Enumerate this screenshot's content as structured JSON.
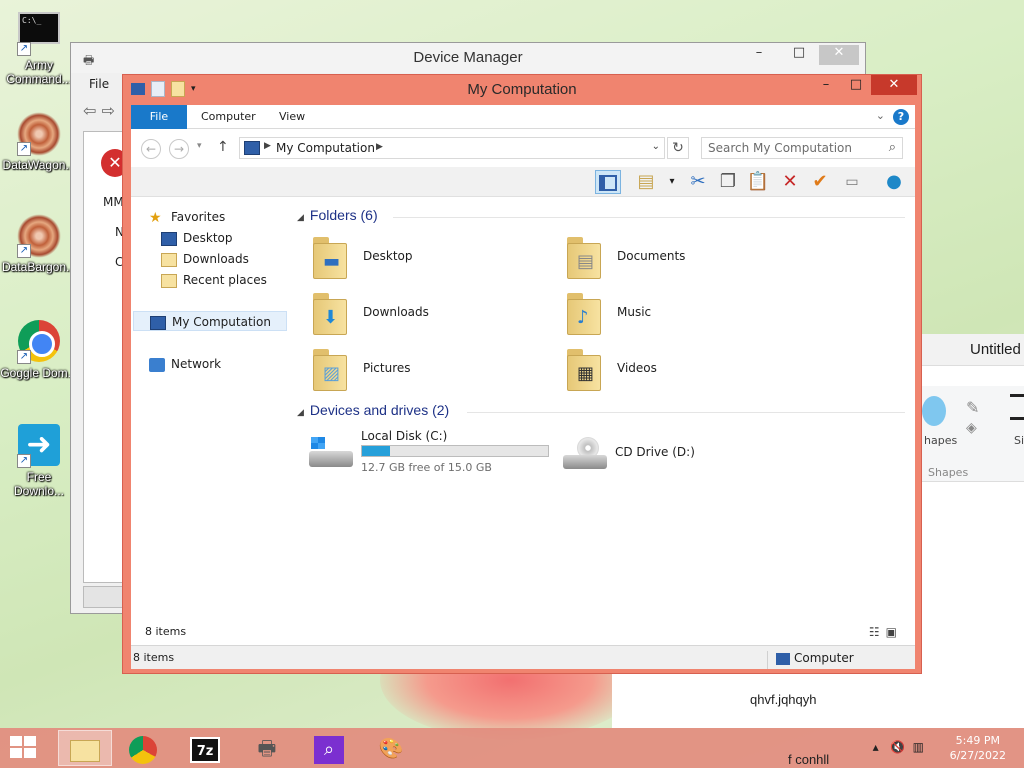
{
  "desktop": {
    "icons": [
      {
        "label": "Army Command..."
      },
      {
        "label": "DataWagon..."
      },
      {
        "label": "DataBargon..."
      },
      {
        "label": "Goggle Dom..."
      },
      {
        "label": "Free Downlo..."
      }
    ]
  },
  "device_manager": {
    "title": "Device Manager",
    "menu_file": "File",
    "snippets": [
      "MM",
      "N",
      "C"
    ]
  },
  "paint": {
    "title": "Untitled",
    "shapes_label": "hapes",
    "shapes_group": "Shapes",
    "size_label": "Size",
    "canvas_text": "qhvf.jqhqyh"
  },
  "explorer": {
    "title": "My Computation",
    "tabs": {
      "file": "File",
      "computer": "Computer",
      "view": "View"
    },
    "address": {
      "crumb": "My Computation"
    },
    "search": {
      "placeholder": "Search My Computation"
    },
    "nav": {
      "favorites": "Favorites",
      "desktop": "Desktop",
      "downloads": "Downloads",
      "recent": "Recent places",
      "computer": "My Computation",
      "network": "Network"
    },
    "folders_group": "Folders (6)",
    "folders": [
      {
        "name": "Desktop"
      },
      {
        "name": "Documents"
      },
      {
        "name": "Downloads"
      },
      {
        "name": "Music"
      },
      {
        "name": "Pictures"
      },
      {
        "name": "Videos"
      }
    ],
    "drives_group": "Devices and drives (2)",
    "drives": [
      {
        "name": "Local Disk (C:)",
        "free": "12.7 GB free of 15.0 GB",
        "used_fraction": 0.153
      },
      {
        "name": "CD Drive (D:)"
      }
    ],
    "status_items": "8 items",
    "status_items2": "8 items",
    "status_zone": "Computer"
  },
  "taskbar": {
    "time": "5:49 PM",
    "date": "6/27/2022",
    "tray_text": "f conhll"
  },
  "colors": {
    "accent": "#1979ca",
    "window_frame": "#f0846f",
    "drive_bar": "#26a0da"
  }
}
